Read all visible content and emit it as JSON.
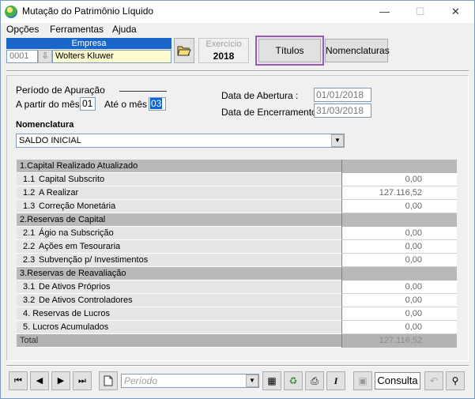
{
  "window": {
    "title": "Mutação do Patrimônio Líquido"
  },
  "menu": {
    "items": [
      {
        "label": "Opções",
        "accel": "O"
      },
      {
        "label": "Ferramentas",
        "accel": "F"
      },
      {
        "label": "Ajuda",
        "accel": "A"
      }
    ]
  },
  "empresa": {
    "label": "Empresa",
    "code": "0001",
    "name": "Wolters Kluwer"
  },
  "exercicio": {
    "label": "Exercício",
    "year": "2018"
  },
  "buttons": {
    "titulos": "Títulos",
    "nomenclaturas": "Nomenclaturas"
  },
  "periodo": {
    "title": "Período de Apuração",
    "from_label": "A partir do mês",
    "from_value": "01",
    "to_label": "Até o mês",
    "to_value": "03"
  },
  "datas": {
    "abertura_label": "Data de Abertura :",
    "abertura_value": "01/01/2018",
    "encerramento_label": "Data de Encerramento :",
    "encerramento_value": "31/03/2018"
  },
  "nomenclatura": {
    "label": "Nomenclatura",
    "selected": "SALDO INICIAL"
  },
  "grid": {
    "rows": [
      {
        "type": "group",
        "code": "",
        "label": "1.Capital Realizado Atualizado",
        "value": ""
      },
      {
        "type": "item",
        "code": "1.1",
        "label": "Capital Subscrito",
        "value": "0,00"
      },
      {
        "type": "item",
        "code": "1.2",
        "label": "A Realizar",
        "value": "127.116,52"
      },
      {
        "type": "item",
        "code": "1.3",
        "label": "Correção Monetária",
        "value": "0,00"
      },
      {
        "type": "group",
        "code": "",
        "label": "2.Reservas de Capital",
        "value": ""
      },
      {
        "type": "item",
        "code": "2.1",
        "label": "Ágio na Subscrição",
        "value": "0,00"
      },
      {
        "type": "item",
        "code": "2.2",
        "label": "Ações em Tesouraria",
        "value": "0,00"
      },
      {
        "type": "item",
        "code": "2.3",
        "label": "Subvenção p/ Investimentos",
        "value": "0,00"
      },
      {
        "type": "group",
        "code": "",
        "label": "3.Reservas de Reavaliação",
        "value": ""
      },
      {
        "type": "item",
        "code": "3.1",
        "label": "De Ativos Próprios",
        "value": "0,00"
      },
      {
        "type": "item",
        "code": "3.2",
        "label": "De Ativos Controladores",
        "value": "0,00"
      },
      {
        "type": "item",
        "code": "",
        "label": "4. Reservas de Lucros",
        "value": "0,00"
      },
      {
        "type": "item",
        "code": "",
        "label": "5. Lucros Acumulados",
        "value": "0,00"
      },
      {
        "type": "total",
        "code": "",
        "label": "Total",
        "value": "127.116,52"
      }
    ]
  },
  "footer": {
    "periodo_placeholder": "Período",
    "consulta": "Consulta"
  },
  "colors": {
    "accent": "#1a66c8",
    "highlight": "#9b59b6",
    "group_row": "#b9b9b9",
    "item_row": "#e6e6e6"
  }
}
